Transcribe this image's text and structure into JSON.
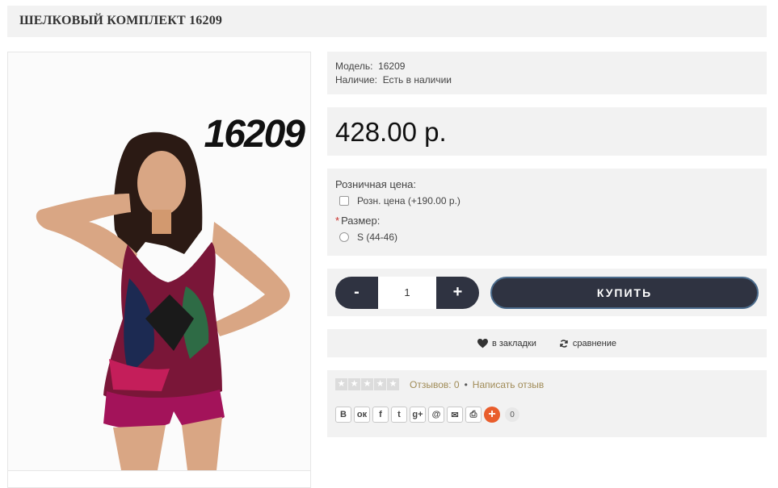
{
  "product": {
    "title": "ШЕЛКОВЫЙ КОМПЛЕКТ 16209",
    "image_alt": "16209",
    "model_label": "Модель:",
    "model_value": "16209",
    "availability_label": "Наличие:",
    "availability_value": "Есть в наличии",
    "price": "428.00 р."
  },
  "options": {
    "retail_label": "Розничная цена:",
    "retail_checkbox_label": "Розн. цена (+190.00 р.)",
    "size_required_mark": "*",
    "size_label": "Размер:",
    "size_option": "S (44-46)"
  },
  "buy": {
    "minus": "-",
    "quantity": "1",
    "plus": "+",
    "buy_label": "КУПИТЬ"
  },
  "actions": {
    "wishlist_label": "в закладки",
    "compare_label": "сравнение"
  },
  "reviews": {
    "reviews_label": "Отзывов: 0",
    "separator": "•",
    "write_label": "Написать отзыв"
  },
  "share": {
    "buttons": [
      "В",
      "ок",
      "f",
      "t",
      "g+",
      "@",
      "✉",
      "⎙"
    ],
    "plus": "+",
    "count": "0"
  },
  "colors": {
    "dark": "#2f3341",
    "panel": "#f2f2f2",
    "instock": "#2a9a3c",
    "link": "#a08b57",
    "share_plus": "#e95d2c"
  }
}
